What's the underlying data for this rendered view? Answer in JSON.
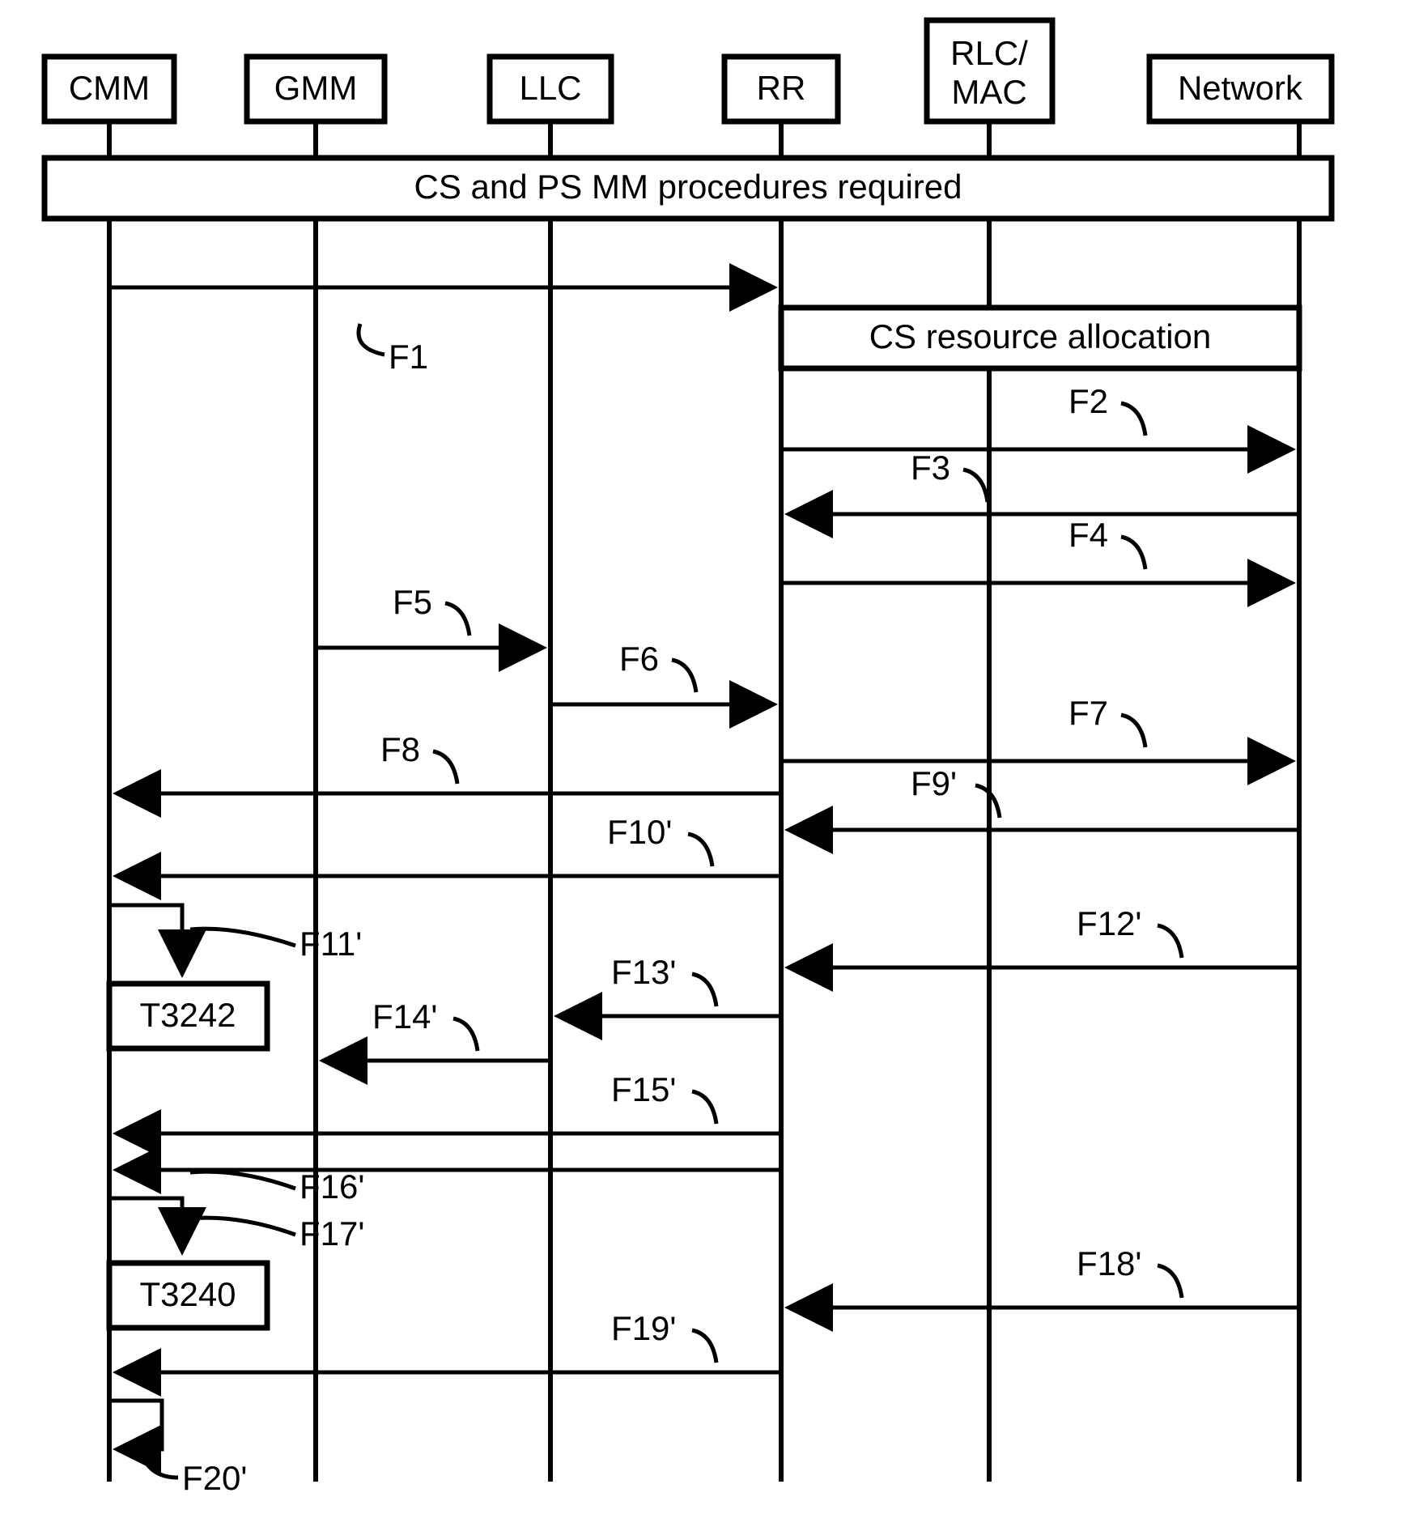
{
  "chart_data": {
    "type": "sequence-diagram",
    "participants": [
      "CMM",
      "GMM",
      "LLC",
      "RR",
      "RLC/\nMAC",
      "Network"
    ],
    "title_block": "CS and PS MM procedures required",
    "sub_block": "CS resource allocation",
    "timers": [
      "T3242",
      "T3240"
    ],
    "messages": [
      {
        "id": "F1",
        "from": "CMM",
        "to": "RR",
        "dir": "right"
      },
      {
        "id": "F2",
        "from": "RR",
        "to": "Network",
        "dir": "right"
      },
      {
        "id": "F3",
        "from": "Network",
        "to": "RR",
        "dir": "left"
      },
      {
        "id": "F4",
        "from": "RR",
        "to": "Network",
        "dir": "right"
      },
      {
        "id": "F5",
        "from": "GMM",
        "to": "LLC",
        "dir": "right"
      },
      {
        "id": "F6",
        "from": "LLC",
        "to": "RR",
        "dir": "right"
      },
      {
        "id": "F7",
        "from": "RR",
        "to": "Network",
        "dir": "right"
      },
      {
        "id": "F8",
        "from": "RR",
        "to": "CMM",
        "dir": "left"
      },
      {
        "id": "F9'",
        "from": "Network",
        "to": "RR",
        "dir": "left"
      },
      {
        "id": "F10'",
        "from": "RR",
        "to": "CMM",
        "dir": "left"
      },
      {
        "id": "F11'",
        "type": "self",
        "on": "CMM"
      },
      {
        "id": "F12'",
        "from": "Network",
        "to": "RR",
        "dir": "left"
      },
      {
        "id": "F13'",
        "from": "RR",
        "to": "LLC",
        "dir": "left"
      },
      {
        "id": "F14'",
        "from": "LLC",
        "to": "GMM",
        "dir": "left"
      },
      {
        "id": "F15'",
        "from": "RR",
        "to": "CMM",
        "dir": "left"
      },
      {
        "id": "F16'",
        "from": "RR",
        "to": "CMM",
        "dir": "left"
      },
      {
        "id": "F17'",
        "type": "self",
        "on": "CMM"
      },
      {
        "id": "F18'",
        "from": "Network",
        "to": "RR",
        "dir": "left"
      },
      {
        "id": "F19'",
        "from": "RR",
        "to": "CMM",
        "dir": "left"
      },
      {
        "id": "F20'",
        "type": "self",
        "on": "CMM"
      }
    ]
  },
  "participants": {
    "p0": "CMM",
    "p1": "GMM",
    "p2": "LLC",
    "p3": "RR",
    "p4a": "RLC/",
    "p4b": "MAC",
    "p5": "Network"
  },
  "blocks": {
    "main": "CS and PS MM procedures required",
    "cs": "CS resource allocation"
  },
  "timer1": "T3242",
  "timer2": "T3240",
  "labels": {
    "F1": "F1",
    "F2": "F2",
    "F3": "F3",
    "F4": "F4",
    "F5": "F5",
    "F6": "F6",
    "F7": "F7",
    "F8": "F8",
    "F9": "F9'",
    "F10": "F10'",
    "F11": "F11'",
    "F12": "F12'",
    "F13": "F13'",
    "F14": "F14'",
    "F15": "F15'",
    "F16": "F16'",
    "F17": "F17'",
    "F18": "F18'",
    "F19": "F19'",
    "F20": "F20'"
  }
}
